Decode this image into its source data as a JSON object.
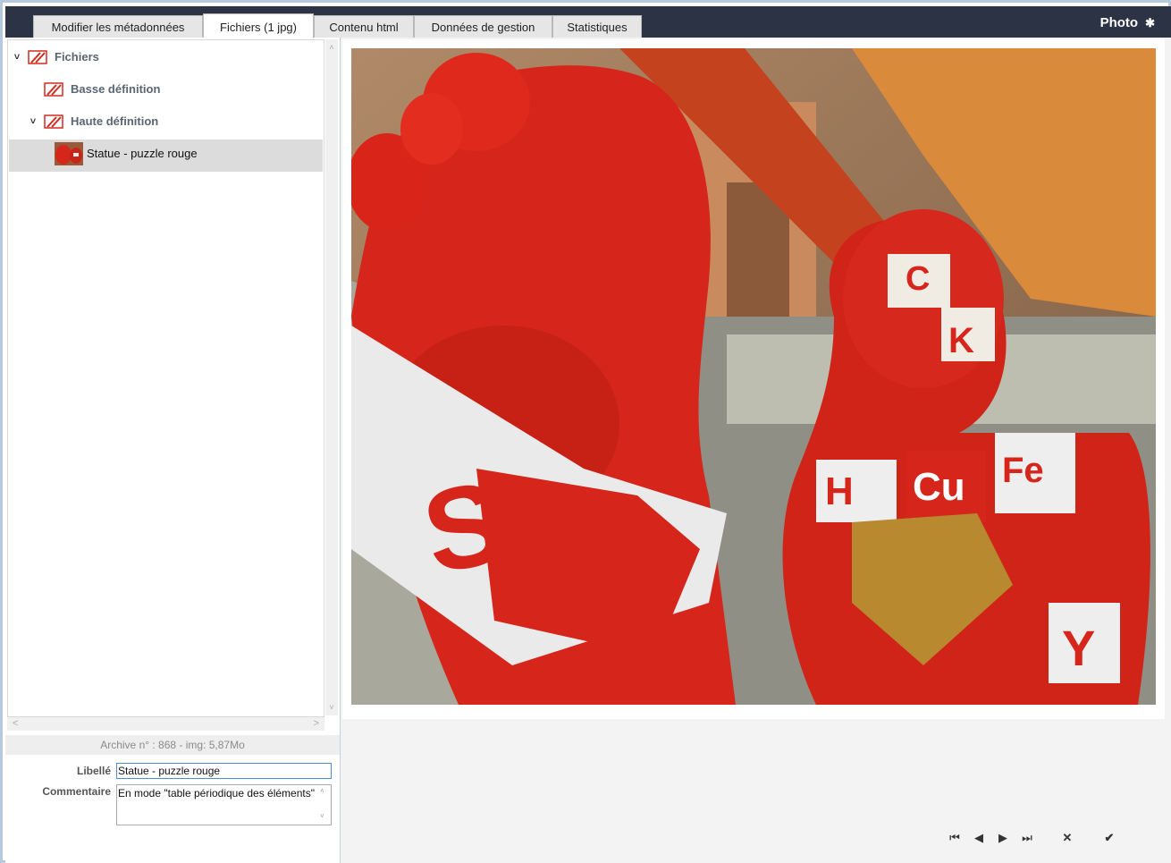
{
  "tabs": [
    {
      "label": "Modifier les métadonnées"
    },
    {
      "label": "Fichiers (1 jpg)"
    },
    {
      "label": "Contenu html"
    },
    {
      "label": "Données de gestion"
    },
    {
      "label": "Statistiques"
    }
  ],
  "brand": {
    "title": "Photo",
    "icon": "gear-icon"
  },
  "tree": {
    "root": "Fichiers",
    "low_def": "Basse définition",
    "high_def": "Haute définition",
    "selected_file": "Statue - puzzle rouge"
  },
  "archive_info": "Archive n° : 868 - img: 5,87Mo",
  "form": {
    "libelle_label": "Libellé",
    "libelle_value": "Statue - puzzle rouge",
    "commentaire_label": "Commentaire",
    "commentaire_value": "En mode \"table périodique des éléments\""
  },
  "photo": {
    "letters": [
      "S",
      "C",
      "K",
      "H",
      "Cu",
      "Fe",
      "Y"
    ]
  },
  "nav_icons": [
    "first-icon",
    "prev-icon",
    "next-icon",
    "last-icon",
    "cancel-icon",
    "confirm-icon"
  ],
  "colors": {
    "topbar": "#2b3345",
    "accent_red": "#d42a1e",
    "border_blue": "#b7c9df"
  }
}
